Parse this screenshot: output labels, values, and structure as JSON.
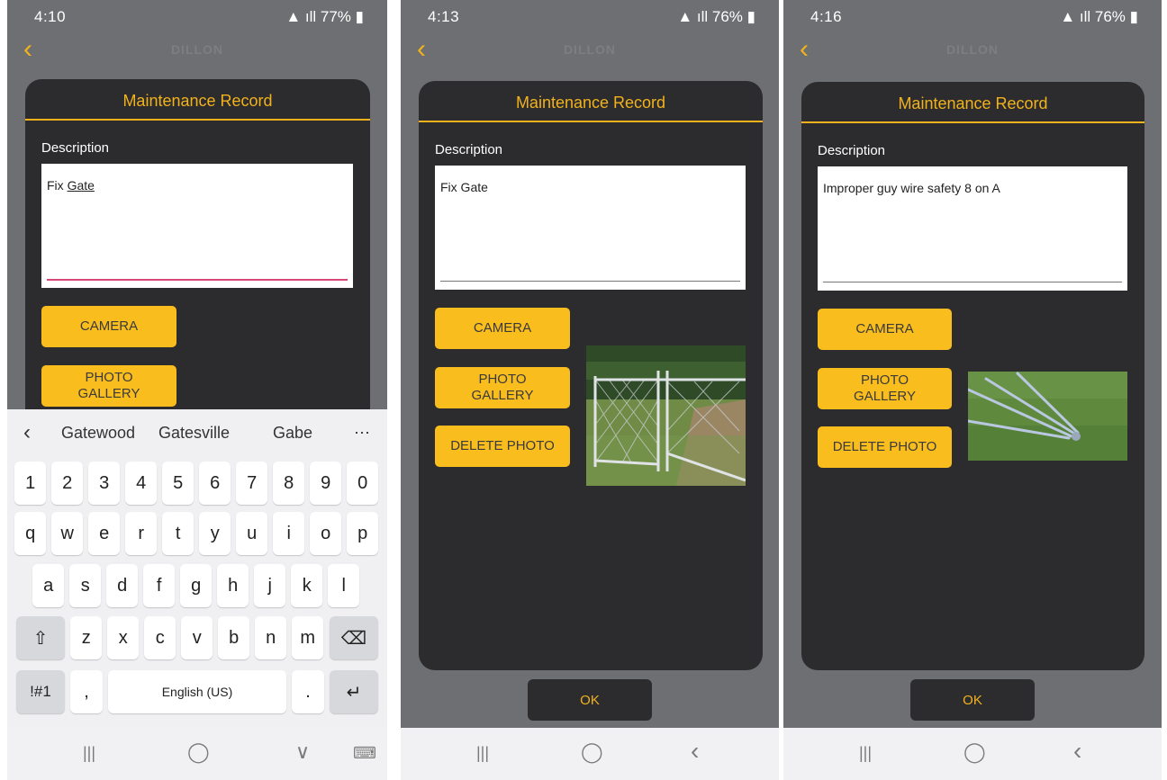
{
  "screens": [
    {
      "status_time": "4:10",
      "status_battery": "77%",
      "logo": "DILLON",
      "title": "Maintenance Record",
      "description_label": "Description",
      "description_prefix": "Fix ",
      "description_underlined": "Gate",
      "camera_label": "CAMERA",
      "gallery_line1": "PHOTO",
      "gallery_line2": "GALLERY",
      "keyboard": {
        "suggestions": [
          "Gatewood",
          "Gatesville",
          "Gabe"
        ],
        "more": "⋯",
        "back": "‹",
        "numbers": [
          "1",
          "2",
          "3",
          "4",
          "5",
          "6",
          "7",
          "8",
          "9",
          "0"
        ],
        "row1": [
          "q",
          "w",
          "e",
          "r",
          "t",
          "y",
          "u",
          "i",
          "o",
          "p"
        ],
        "row2": [
          "a",
          "s",
          "d",
          "f",
          "g",
          "h",
          "j",
          "k",
          "l"
        ],
        "row3": [
          "z",
          "x",
          "c",
          "v",
          "b",
          "n",
          "m"
        ],
        "shift": "⇧",
        "backspace": "⌫",
        "symbols": "!#1",
        "comma": ",",
        "space": "English (US)",
        "period": ".",
        "enter": "↵"
      },
      "nav": {
        "recents": "|||",
        "home": "◯",
        "back": "∨",
        "keyboard": "⌨"
      }
    },
    {
      "status_time": "4:13",
      "status_battery": "76%",
      "logo": "DILLON",
      "title": "Maintenance Record",
      "description_label": "Description",
      "description": "Fix Gate",
      "camera_label": "CAMERA",
      "gallery_line1": "PHOTO",
      "gallery_line2": "GALLERY",
      "delete_label": "DELETE PHOTO",
      "ok_label": "OK",
      "nav": {
        "recents": "|||",
        "home": "◯",
        "back": "‹"
      }
    },
    {
      "status_time": "4:16",
      "status_battery": "76%",
      "logo": "DILLON",
      "title": "Maintenance Record",
      "description_label": "Description",
      "description": "Improper guy wire safety 8 on A",
      "camera_label": "CAMERA",
      "gallery_line1": "PHOTO",
      "gallery_line2": "GALLERY",
      "delete_label": "DELETE PHOTO",
      "ok_label": "OK",
      "nav": {
        "recents": "|||",
        "home": "◯",
        "back": "‹"
      }
    }
  ],
  "icons": {
    "back_chevron": "chevron-left-icon"
  },
  "colors": {
    "accent": "#f2b21c",
    "button": "#f9bd1e",
    "card": "#2c2c2e",
    "screen_bg": "#6e6f72"
  }
}
